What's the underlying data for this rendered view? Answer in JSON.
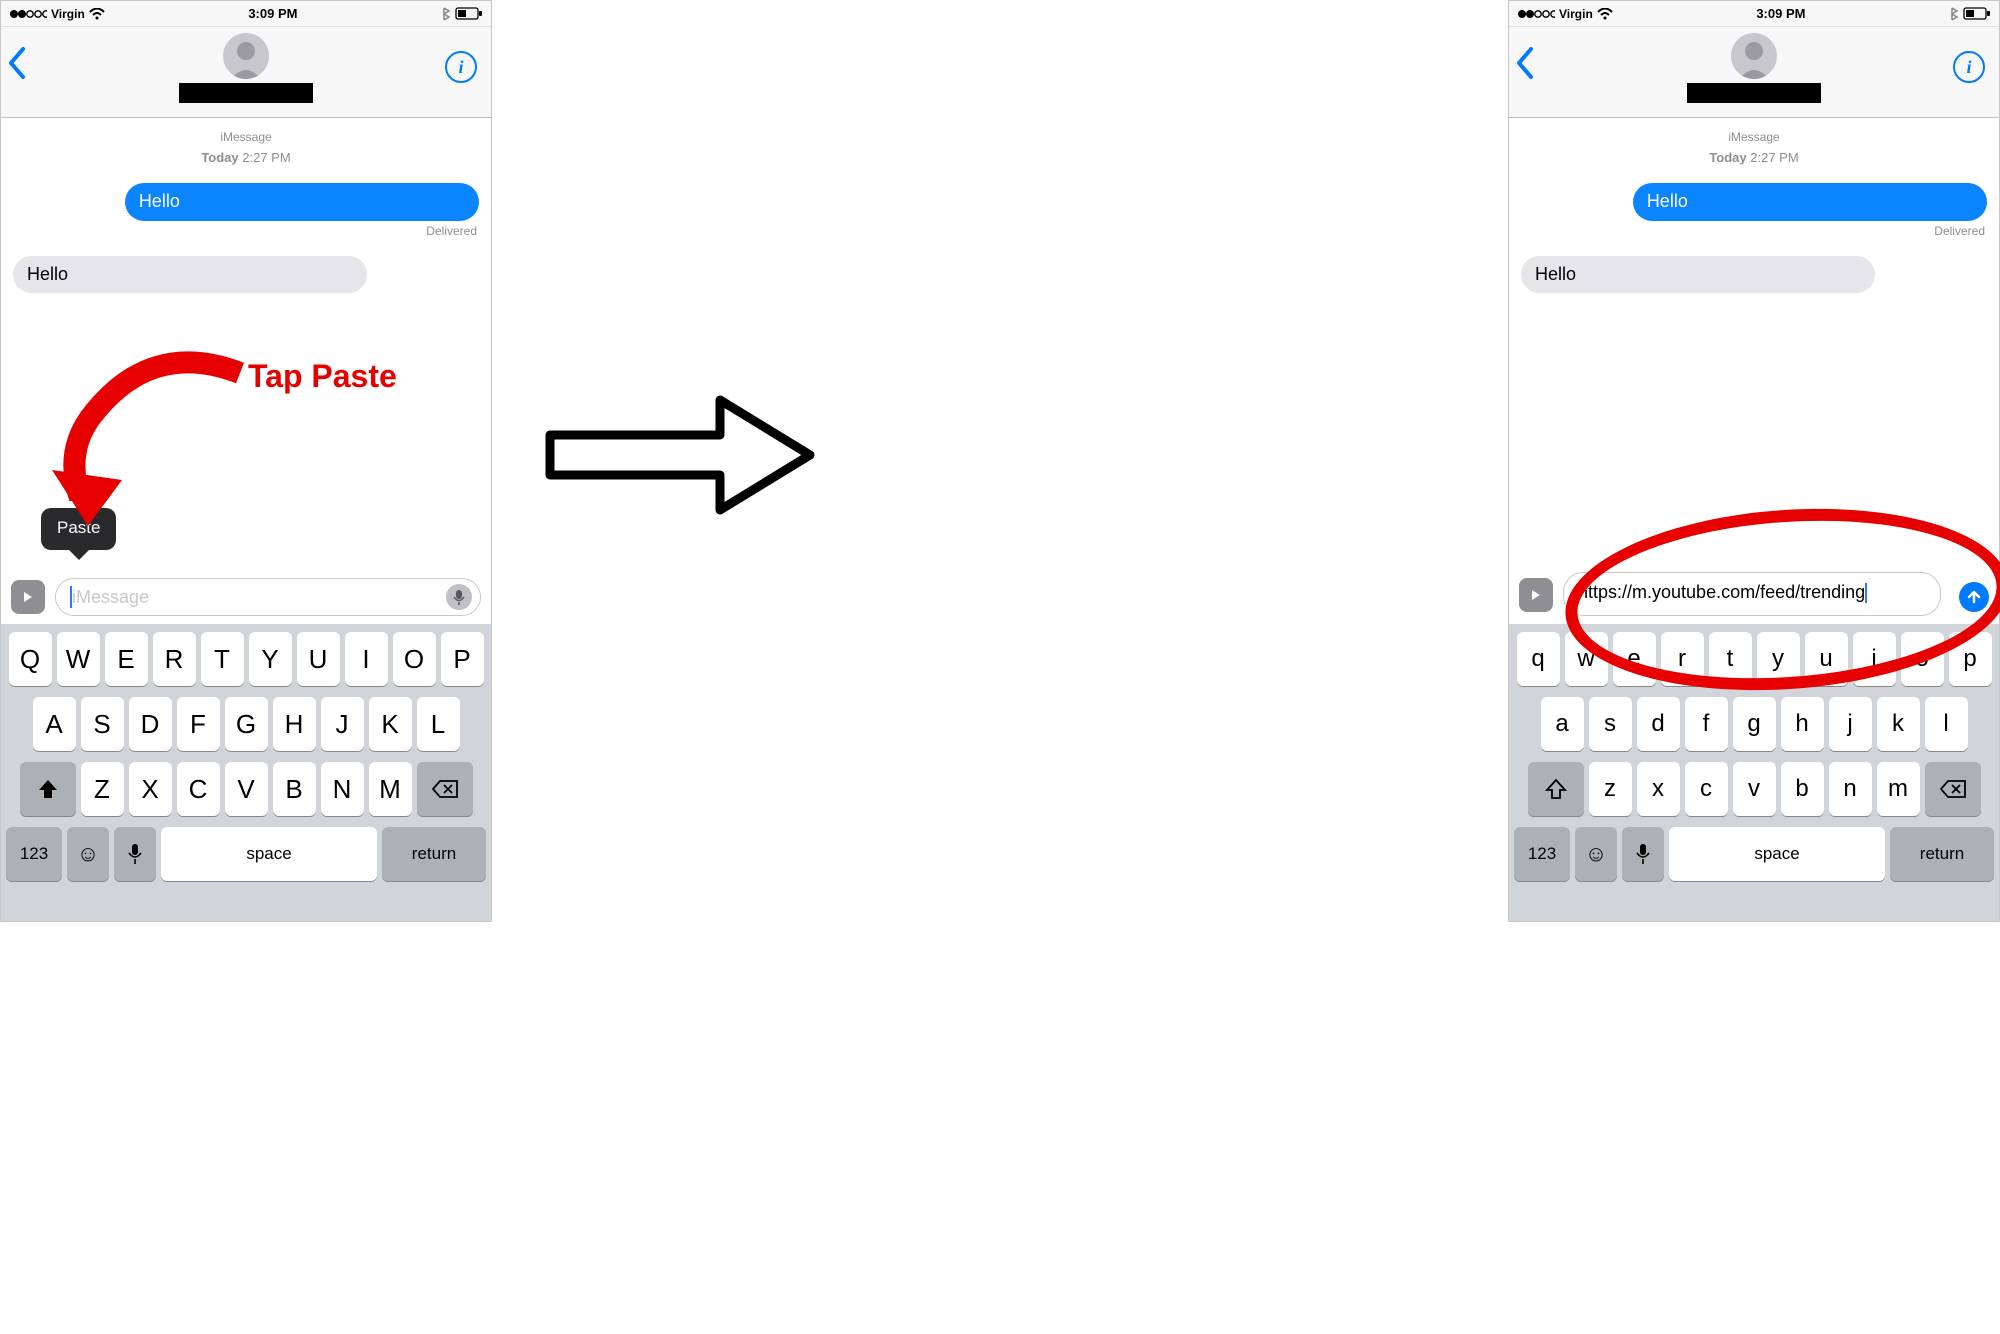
{
  "status": {
    "carrier": "Virgin",
    "time": "3:09 PM"
  },
  "thread": {
    "service": "iMessage",
    "today_label": "Today",
    "today_time": "2:27 PM",
    "sent_message": "Hello",
    "delivered_label": "Delivered",
    "received_message": "Hello"
  },
  "compose": {
    "placeholder": "iMessage",
    "pasted_value": "https://m.youtube.com/feed/trending"
  },
  "popover": {
    "paste_label": "Paste"
  },
  "keyboard": {
    "row1_upper": [
      "Q",
      "W",
      "E",
      "R",
      "T",
      "Y",
      "U",
      "I",
      "O",
      "P"
    ],
    "row2_upper": [
      "A",
      "S",
      "D",
      "F",
      "G",
      "H",
      "J",
      "K",
      "L"
    ],
    "row3_upper": [
      "Z",
      "X",
      "C",
      "V",
      "B",
      "N",
      "M"
    ],
    "row1_lower": [
      "q",
      "w",
      "e",
      "r",
      "t",
      "y",
      "u",
      "i",
      "o",
      "p"
    ],
    "row2_lower": [
      "a",
      "s",
      "d",
      "f",
      "g",
      "h",
      "j",
      "k",
      "l"
    ],
    "row3_lower": [
      "z",
      "x",
      "c",
      "v",
      "b",
      "n",
      "m"
    ],
    "num_label": "123",
    "space_label": "space",
    "return_label": "return"
  },
  "annotation": {
    "tap_paste": "Tap Paste"
  }
}
